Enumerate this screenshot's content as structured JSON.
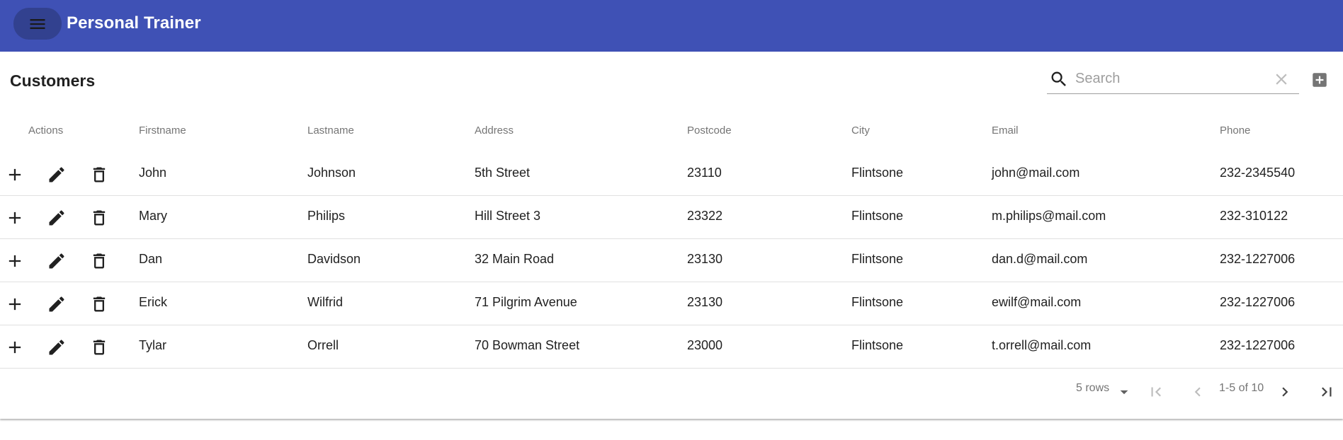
{
  "app": {
    "title": "Personal Trainer"
  },
  "page": {
    "title": "Customers"
  },
  "search": {
    "placeholder": "Search",
    "value": ""
  },
  "table": {
    "columns": {
      "actions": "Actions",
      "firstname": "Firstname",
      "lastname": "Lastname",
      "address": "Address",
      "postcode": "Postcode",
      "city": "City",
      "email": "Email",
      "phone": "Phone"
    },
    "rows": [
      {
        "firstname": "John",
        "lastname": "Johnson",
        "address": "5th Street",
        "postcode": "23110",
        "city": "Flintsone",
        "email": "john@mail.com",
        "phone": "232-2345540"
      },
      {
        "firstname": "Mary",
        "lastname": "Philips",
        "address": "Hill Street 3",
        "postcode": "23322",
        "city": "Flintsone",
        "email": "m.philips@mail.com",
        "phone": "232-310122"
      },
      {
        "firstname": "Dan",
        "lastname": "Davidson",
        "address": "32 Main Road",
        "postcode": "23130",
        "city": "Flintsone",
        "email": "dan.d@mail.com",
        "phone": "232-1227006"
      },
      {
        "firstname": "Erick",
        "lastname": "Wilfrid",
        "address": "71 Pilgrim Avenue",
        "postcode": "23130",
        "city": "Flintsone",
        "email": "ewilf@mail.com",
        "phone": "232-1227006"
      },
      {
        "firstname": "Tylar",
        "lastname": "Orrell",
        "address": "70 Bowman Street",
        "postcode": "23000",
        "city": "Flintsone",
        "email": "t.orrell@mail.com",
        "phone": "232-1227006"
      }
    ]
  },
  "pagination": {
    "rows_per_page": "5 rows",
    "range": "1-5 of 10"
  },
  "icons": {
    "menu": "menu-icon",
    "search": "search-icon",
    "clear": "close-icon",
    "add": "add-box-icon",
    "row_add": "plus-icon",
    "row_edit": "pencil-icon",
    "row_delete": "trash-icon",
    "dropdown": "caret-down-icon",
    "first": "first-page-icon",
    "prev": "chevron-left-icon",
    "next": "chevron-right-icon",
    "last": "last-page-icon"
  },
  "colors": {
    "primary": "#3f51b5",
    "menu_button": "#32418f",
    "text": "#212121",
    "muted": "#757575",
    "divider": "#e0e0e0"
  }
}
